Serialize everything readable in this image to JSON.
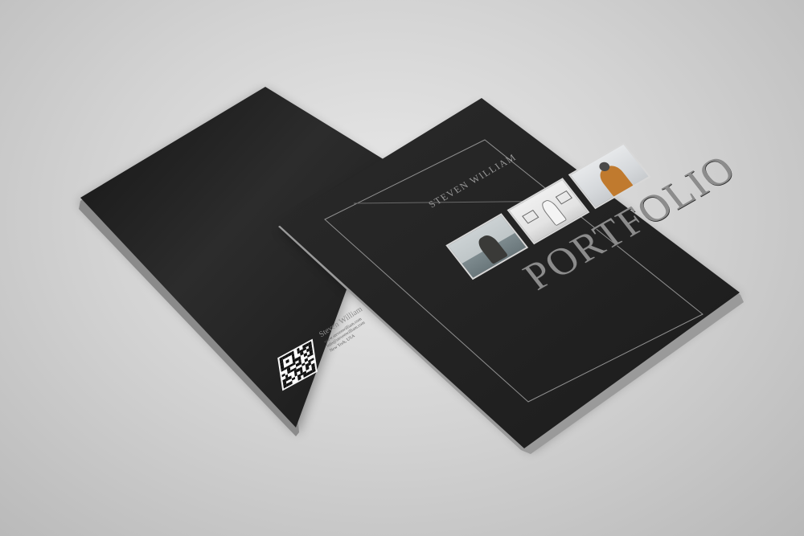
{
  "front_cover": {
    "author": "STEVEN WILLIAM",
    "title": "PORTFOLIO",
    "photos": [
      "person-by-sea-photo",
      "person-in-gallery-photo",
      "person-in-orange-jacket-photo"
    ]
  },
  "back_cover": {
    "name": "Steven William",
    "lines": [
      "www.stevenwilliam.com",
      "info@stevenwilliam.com",
      "New York, USA"
    ],
    "qr": "qr-code"
  },
  "colors": {
    "cover": "#1f1f1f",
    "frame": "#8f8f8f",
    "text": "#9a9a9a",
    "background": "#d6d6d6"
  }
}
